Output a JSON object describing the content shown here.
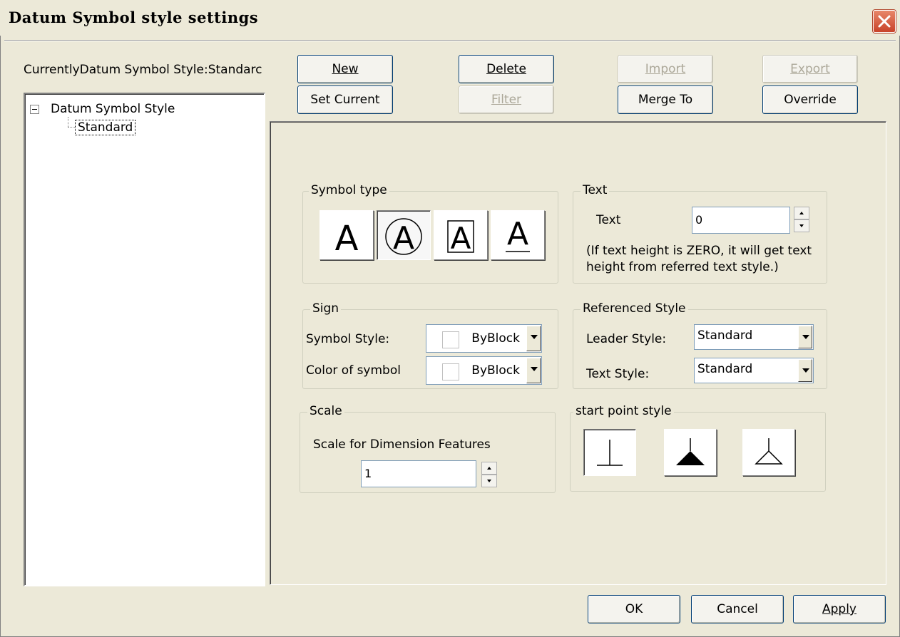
{
  "window": {
    "title": "Datum Symbol style settings"
  },
  "current_style": "CurrentlyDatum Symbol Style:Standarc",
  "tree": {
    "root": "Datum Symbol Style",
    "child": "Standard"
  },
  "toolbar": {
    "new": "New",
    "delete": "Delete",
    "import": "Import",
    "export": "Export",
    "set_current": "Set Current",
    "filter": "Filter",
    "merge_to": "Merge To",
    "override": "Override"
  },
  "symbol_type": {
    "label": "Symbol type",
    "options": [
      "A",
      "A",
      "A",
      "A"
    ],
    "icons": [
      "plain-letter-icon",
      "circled-letter-icon",
      "boxed-letter-icon",
      "underlined-letter-icon"
    ],
    "selected_index": 1
  },
  "text_group": {
    "label": "Text",
    "field_label": "Text",
    "value": "0",
    "note": "(If text height is ZERO, it will get text height from referred text style.)"
  },
  "sign": {
    "label": "Sign",
    "symbol_style_label": "Symbol Style:",
    "symbol_style_value": "ByBlock",
    "color_label": "Color of symbol",
    "color_value": "ByBlock"
  },
  "referenced_style": {
    "label": "Referenced Style",
    "leader_label": "Leader Style:",
    "leader_value": "Standard",
    "text_label": "Text Style:",
    "text_value": "Standard"
  },
  "scale": {
    "label": "Scale",
    "desc": "Scale for Dimension Features",
    "value": "1"
  },
  "start_point": {
    "label": "start point style",
    "icons": [
      "perpendicular-icon",
      "filled-triangle-icon",
      "open-triangle-icon"
    ],
    "selected_index": 0
  },
  "footer": {
    "ok": "OK",
    "cancel": "Cancel",
    "apply": "Apply"
  }
}
